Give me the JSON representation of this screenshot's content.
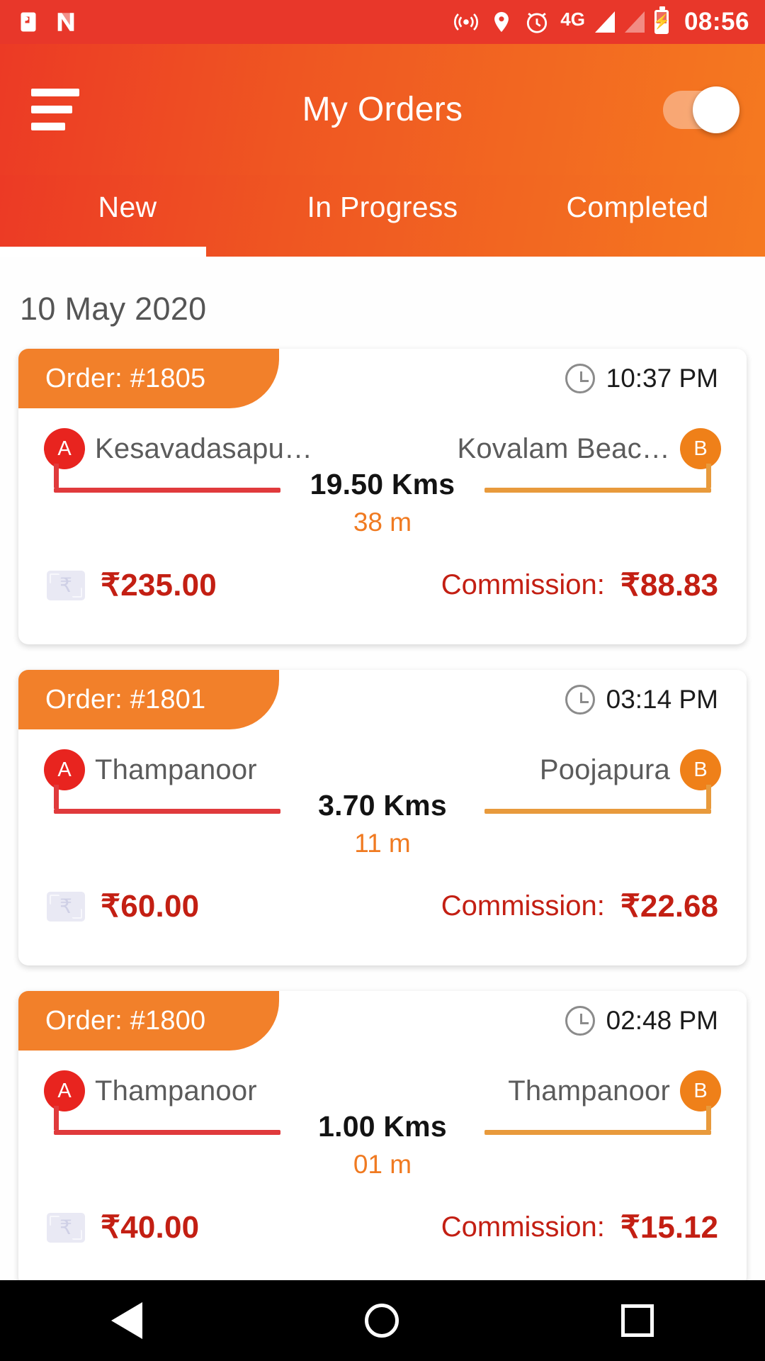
{
  "statusbar": {
    "time": "08:56",
    "network_label": "4G",
    "battery_glyph": "⚡",
    "icons": [
      "cast-icon",
      "nfc-icon",
      "wifi-hotspot-icon",
      "location-pin-icon",
      "alarm-clock-icon",
      "signal-bar-icon",
      "signal-bar-empty-icon",
      "battery-charging-icon"
    ]
  },
  "appbar": {
    "title": "My Orders",
    "menu_icon": "hamburger-menu-icon",
    "toggle_state": "on"
  },
  "tabs": {
    "items": [
      {
        "label": "New",
        "active": true
      },
      {
        "label": "In Progress",
        "active": false
      },
      {
        "label": "Completed",
        "active": false
      }
    ]
  },
  "main": {
    "date_header": "10 May 2020",
    "commission_label": "Commission:",
    "origin_marker": "A",
    "destination_marker": "B",
    "orders": [
      {
        "order_label": "Order: #1805",
        "time": "10:37 PM",
        "origin": "Kesavadasapu…",
        "destination": "Kovalam Beac…",
        "distance": "19.50 Kms",
        "duration": "38 m",
        "fare": "₹235.00",
        "commission": "₹88.83"
      },
      {
        "order_label": "Order: #1801",
        "time": "03:14 PM",
        "origin": "Thampanoor",
        "destination": "Poojapura",
        "distance": "3.70 Kms",
        "duration": "11 m",
        "fare": "₹60.00",
        "commission": "₹22.68"
      },
      {
        "order_label": "Order: #1800",
        "time": "02:48 PM",
        "origin": "Thampanoor",
        "destination": "Thampanoor",
        "distance": "1.00 Kms",
        "duration": "01 m",
        "fare": "₹40.00",
        "commission": "₹15.12"
      }
    ]
  },
  "navbar": {
    "back": "back-triangle-icon",
    "home": "home-circle-icon",
    "recents": "recents-square-icon"
  },
  "colors": {
    "status_red": "#e8372a",
    "appbar_start": "#ec3a25",
    "appbar_end": "#f57920",
    "tag_orange": "#f2802a",
    "pin_a_red": "#e8241f",
    "pin_b_orange": "#ef8019",
    "money_red": "#c31f13",
    "duration_orange": "#f07a21"
  }
}
